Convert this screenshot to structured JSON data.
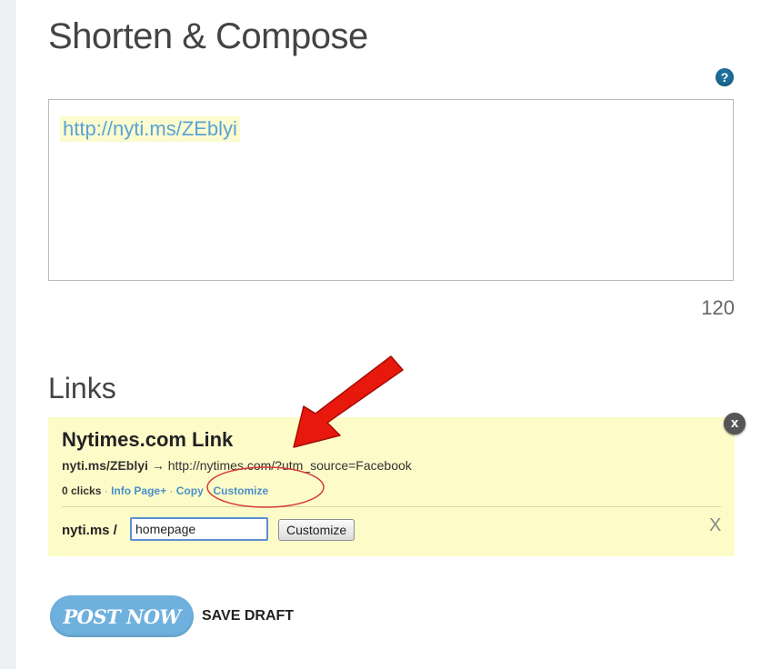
{
  "page": {
    "title": "Shorten & Compose",
    "help_glyph": "?"
  },
  "compose": {
    "text": "http://nyti.ms/ZEblyi",
    "char_count": "120"
  },
  "links": {
    "heading": "Links",
    "card": {
      "title": "Nytimes.com Link",
      "short_url": "nyti.ms/ZEblyi",
      "arrow": "→",
      "long_url": "http://nytimes.com/?utm_source=Facebook",
      "clicks": "0 clicks",
      "sep": "·",
      "info_page": "Info Page+",
      "copy": "Copy",
      "customize_link": "Customize",
      "domain_prefix": "nyti.ms /",
      "slug_value": "homepage",
      "customize_button": "Customize",
      "customize_close": "X",
      "close_glyph": "x"
    }
  },
  "actions": {
    "post_now": "POST NOW",
    "save_draft": "SAVE DRAFT"
  },
  "colors": {
    "accent": "#6fb1de",
    "link": "#4a90c8",
    "card_background": "#fdfcc9",
    "annotation_arrow": "#e8180c",
    "annotation_circle": "#d63a3a"
  },
  "icons": {
    "help": "help-icon",
    "card_close": "close-icon",
    "annotation": "red-arrow-icon"
  }
}
